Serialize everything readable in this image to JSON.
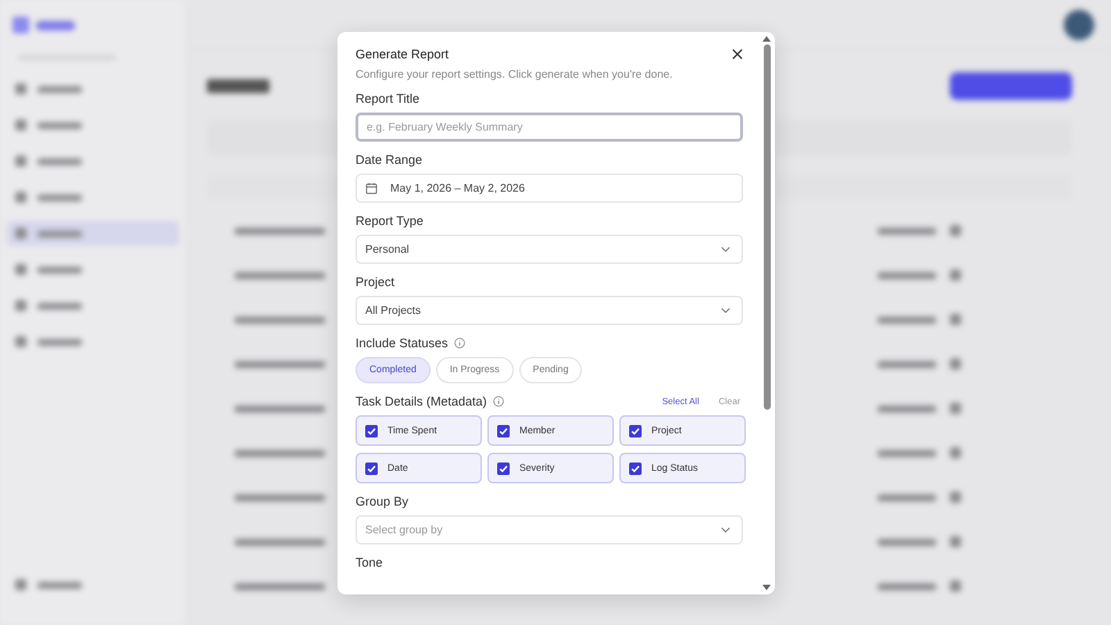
{
  "dialog": {
    "title": "Generate Report",
    "subtitle": "Configure your report settings. Click generate when you're done.",
    "fields": [
      {
        "kind": "text",
        "label": "Report Title",
        "placeholder": "e.g. February Weekly Summary",
        "focused": true
      },
      {
        "kind": "date",
        "label": "Date Range",
        "value": "May 1, 2026 – May 2, 2026"
      },
      {
        "kind": "select",
        "label": "Report Type",
        "value": "Personal"
      },
      {
        "kind": "select",
        "label": "Project",
        "value": "All Projects"
      },
      {
        "kind": "chips",
        "label": "Include Statuses",
        "info": true,
        "options": [
          {
            "label": "Completed",
            "selected": true
          },
          {
            "label": "In Progress",
            "selected": false
          },
          {
            "label": "Pending",
            "selected": false
          }
        ]
      },
      {
        "kind": "checks",
        "label": "Task Details (Metadata)",
        "info": true,
        "select_all": "Select All",
        "clear": "Clear",
        "options": [
          {
            "label": "Time Spent",
            "checked": true
          },
          {
            "label": "Member",
            "checked": true
          },
          {
            "label": "Project",
            "checked": true
          },
          {
            "label": "Date",
            "checked": true
          },
          {
            "label": "Severity",
            "checked": true
          },
          {
            "label": "Log Status",
            "checked": true
          }
        ]
      },
      {
        "kind": "select",
        "label": "Group By",
        "placeholder": "Select group by"
      },
      {
        "kind": "heading",
        "label": "Tone"
      }
    ]
  }
}
